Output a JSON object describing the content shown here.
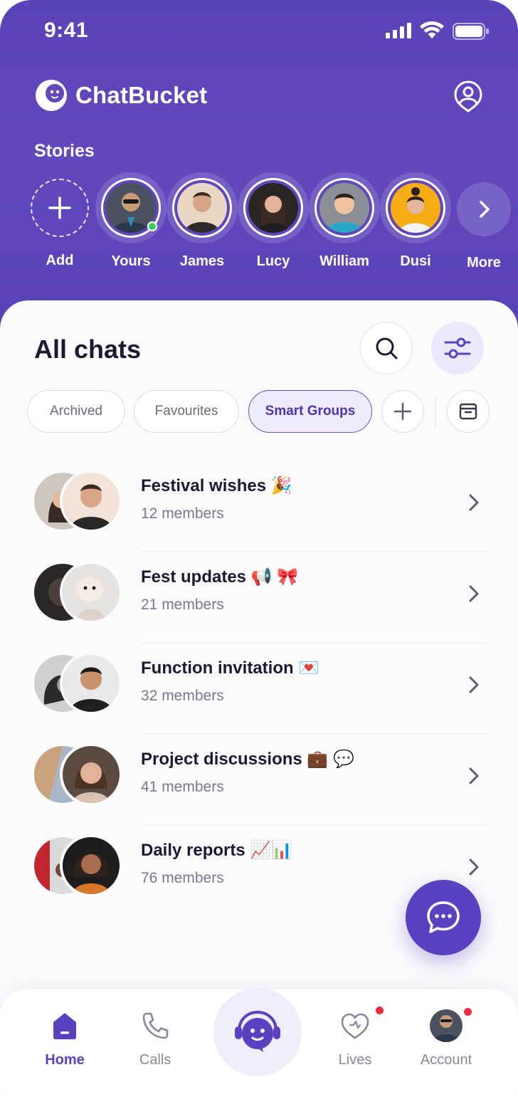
{
  "status_bar": {
    "time": "9:41"
  },
  "app": {
    "name": "ChatBucket"
  },
  "stories": {
    "title": "Stories",
    "items": [
      {
        "label": "Add"
      },
      {
        "label": "Yours"
      },
      {
        "label": "James"
      },
      {
        "label": "Lucy"
      },
      {
        "label": "William"
      },
      {
        "label": "Dusi"
      },
      {
        "label": "More"
      }
    ]
  },
  "chats": {
    "title": "All chats",
    "filters": [
      {
        "label": "Archived",
        "active": false
      },
      {
        "label": "Favourites",
        "active": false
      },
      {
        "label": "Smart Groups",
        "active": true
      }
    ],
    "groups": [
      {
        "title": "Festival wishes 🎉",
        "members": "12 members"
      },
      {
        "title": "Fest updates 📢 🎀",
        "members": "21 members"
      },
      {
        "title": "Function invitation 💌",
        "members": "32 members"
      },
      {
        "title": "Project discussions 💼 💬",
        "members": "41 members"
      },
      {
        "title": "Daily reports 📈📊",
        "members": "76 members"
      }
    ]
  },
  "bottom_nav": {
    "items": [
      {
        "label": "Home",
        "active": true
      },
      {
        "label": "Calls",
        "active": false
      },
      {
        "label": "Lives",
        "active": false
      },
      {
        "label": "Account",
        "active": false
      }
    ]
  },
  "colors": {
    "brand": "#5b40c0",
    "header": "#6247bd",
    "online": "#37d05a",
    "badge": "#ef2c3f"
  }
}
